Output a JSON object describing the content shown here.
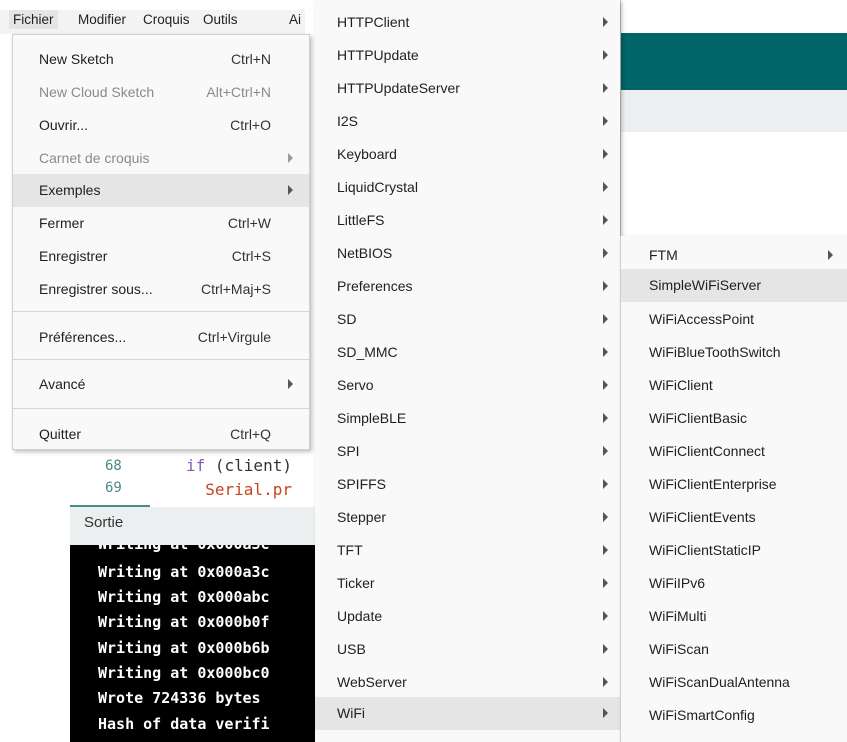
{
  "menubar": {
    "items": [
      "Fichier",
      "Modifier",
      "Croquis",
      "Outils",
      "Ai"
    ]
  },
  "file_menu": {
    "items": [
      {
        "label": "New Sketch",
        "shortcut": "Ctrl+N"
      },
      {
        "label": "New Cloud Sketch",
        "shortcut": "Alt+Ctrl+N"
      },
      {
        "label": "Ouvrir...",
        "shortcut": "Ctrl+O"
      },
      {
        "label": "Carnet de croquis",
        "shortcut": ""
      },
      {
        "label": "Exemples",
        "shortcut": ""
      },
      {
        "label": "Fermer",
        "shortcut": "Ctrl+W"
      },
      {
        "label": "Enregistrer",
        "shortcut": "Ctrl+S"
      },
      {
        "label": "Enregistrer sous...",
        "shortcut": "Ctrl+Maj+S"
      },
      {
        "label": "Préférences...",
        "shortcut": "Ctrl+Virgule"
      },
      {
        "label": "Avancé",
        "shortcut": ""
      },
      {
        "label": "Quitter",
        "shortcut": "Ctrl+Q"
      }
    ]
  },
  "examples_menu": {
    "items": [
      "HTTPClient",
      "HTTPUpdate",
      "HTTPUpdateServer",
      "I2S",
      "Keyboard",
      "LiquidCrystal",
      "LittleFS",
      "NetBIOS",
      "Preferences",
      "SD",
      "SD_MMC",
      "Servo",
      "SimpleBLE",
      "SPI",
      "SPIFFS",
      "Stepper",
      "TFT",
      "Ticker",
      "Update",
      "USB",
      "WebServer",
      "WiFi"
    ]
  },
  "wifi_menu": {
    "items": [
      "FTM",
      "SimpleWiFiServer",
      "WiFiAccessPoint",
      "WiFiBlueToothSwitch",
      "WiFiClient",
      "WiFiClientBasic",
      "WiFiClientConnect",
      "WiFiClientEnterprise",
      "WiFiClientEvents",
      "WiFiClientStaticIP",
      "WiFiIPv6",
      "WiFiMulti",
      "WiFiScan",
      "WiFiScanDualAntenna",
      "WiFiSmartConfig"
    ]
  },
  "editor": {
    "line_numbers": [
      "68",
      "69"
    ],
    "line_68_keyword": "if",
    "line_68_rest": " (client)",
    "line_69": "  Serial.pr"
  },
  "output": {
    "title": "Sortie",
    "lines": [
      "Writing at 0x000a3c",
      "Writing at 0x000abc",
      "Writing at 0x000b0f",
      "Writing at 0x000b6b",
      "Writing at 0x000bc0",
      "Wrote 724336 bytes",
      "Hash of data verifi"
    ]
  },
  "colors": {
    "header_teal": "#006468",
    "highlight": "#e5e5e5"
  }
}
